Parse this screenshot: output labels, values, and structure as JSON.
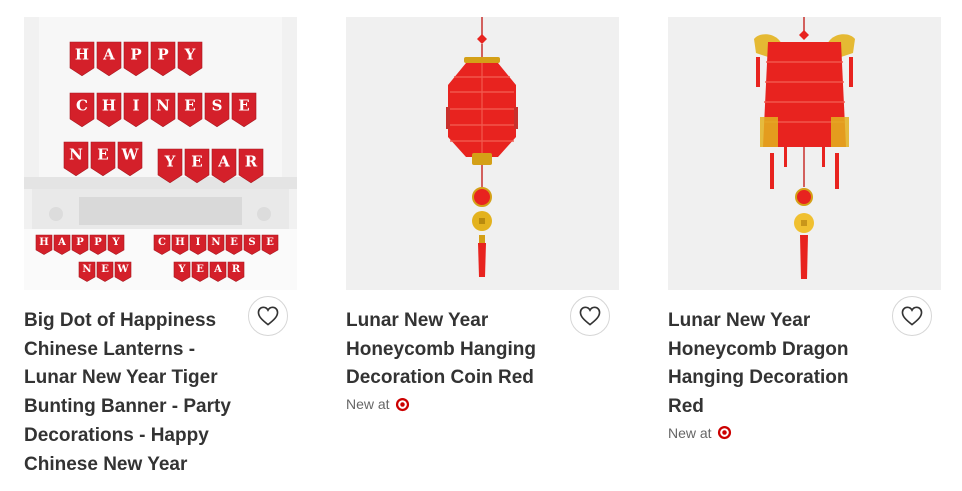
{
  "products": [
    {
      "title": "Big Dot of Happiness Chinese Lanterns - Lunar New Year Tiger Bunting Banner - Party Decorations - Happy Chinese New Year",
      "image_alt": "bunting-banner-image",
      "banner": {
        "row1": [
          "H",
          "A",
          "P",
          "P",
          "Y"
        ],
        "row2": [
          "C",
          "H",
          "I",
          "N",
          "E",
          "S",
          "E"
        ],
        "row3a": [
          "N",
          "E",
          "W"
        ],
        "row3b": [
          "Y",
          "E",
          "A",
          "R"
        ],
        "mini1": [
          "H",
          "A",
          "P",
          "P",
          "Y"
        ],
        "mini2": [
          "C",
          "H",
          "I",
          "N",
          "E",
          "S",
          "E"
        ],
        "mini3": [
          "N",
          "E",
          "W"
        ],
        "mini4": [
          "Y",
          "E",
          "A",
          "R"
        ]
      },
      "new_at": "",
      "favorite_label": "Add to favorites"
    },
    {
      "title": "Lunar New Year Honeycomb Hanging Decoration Coin Red",
      "image_alt": "honeycomb-lantern-image",
      "new_at": "New at",
      "favorite_label": "Add to favorites"
    },
    {
      "title": "Lunar New Year Honeycomb Dragon Hanging Decoration Red",
      "image_alt": "dragon-lantern-image",
      "new_at": "New at",
      "favorite_label": "Add to favorites"
    }
  ],
  "colors": {
    "text": "#333333",
    "muted": "#666666",
    "target_red": "#cc0000",
    "lantern_red": "#e8231f",
    "gold": "#d4a017",
    "image_bg": "#f0f0f0"
  }
}
